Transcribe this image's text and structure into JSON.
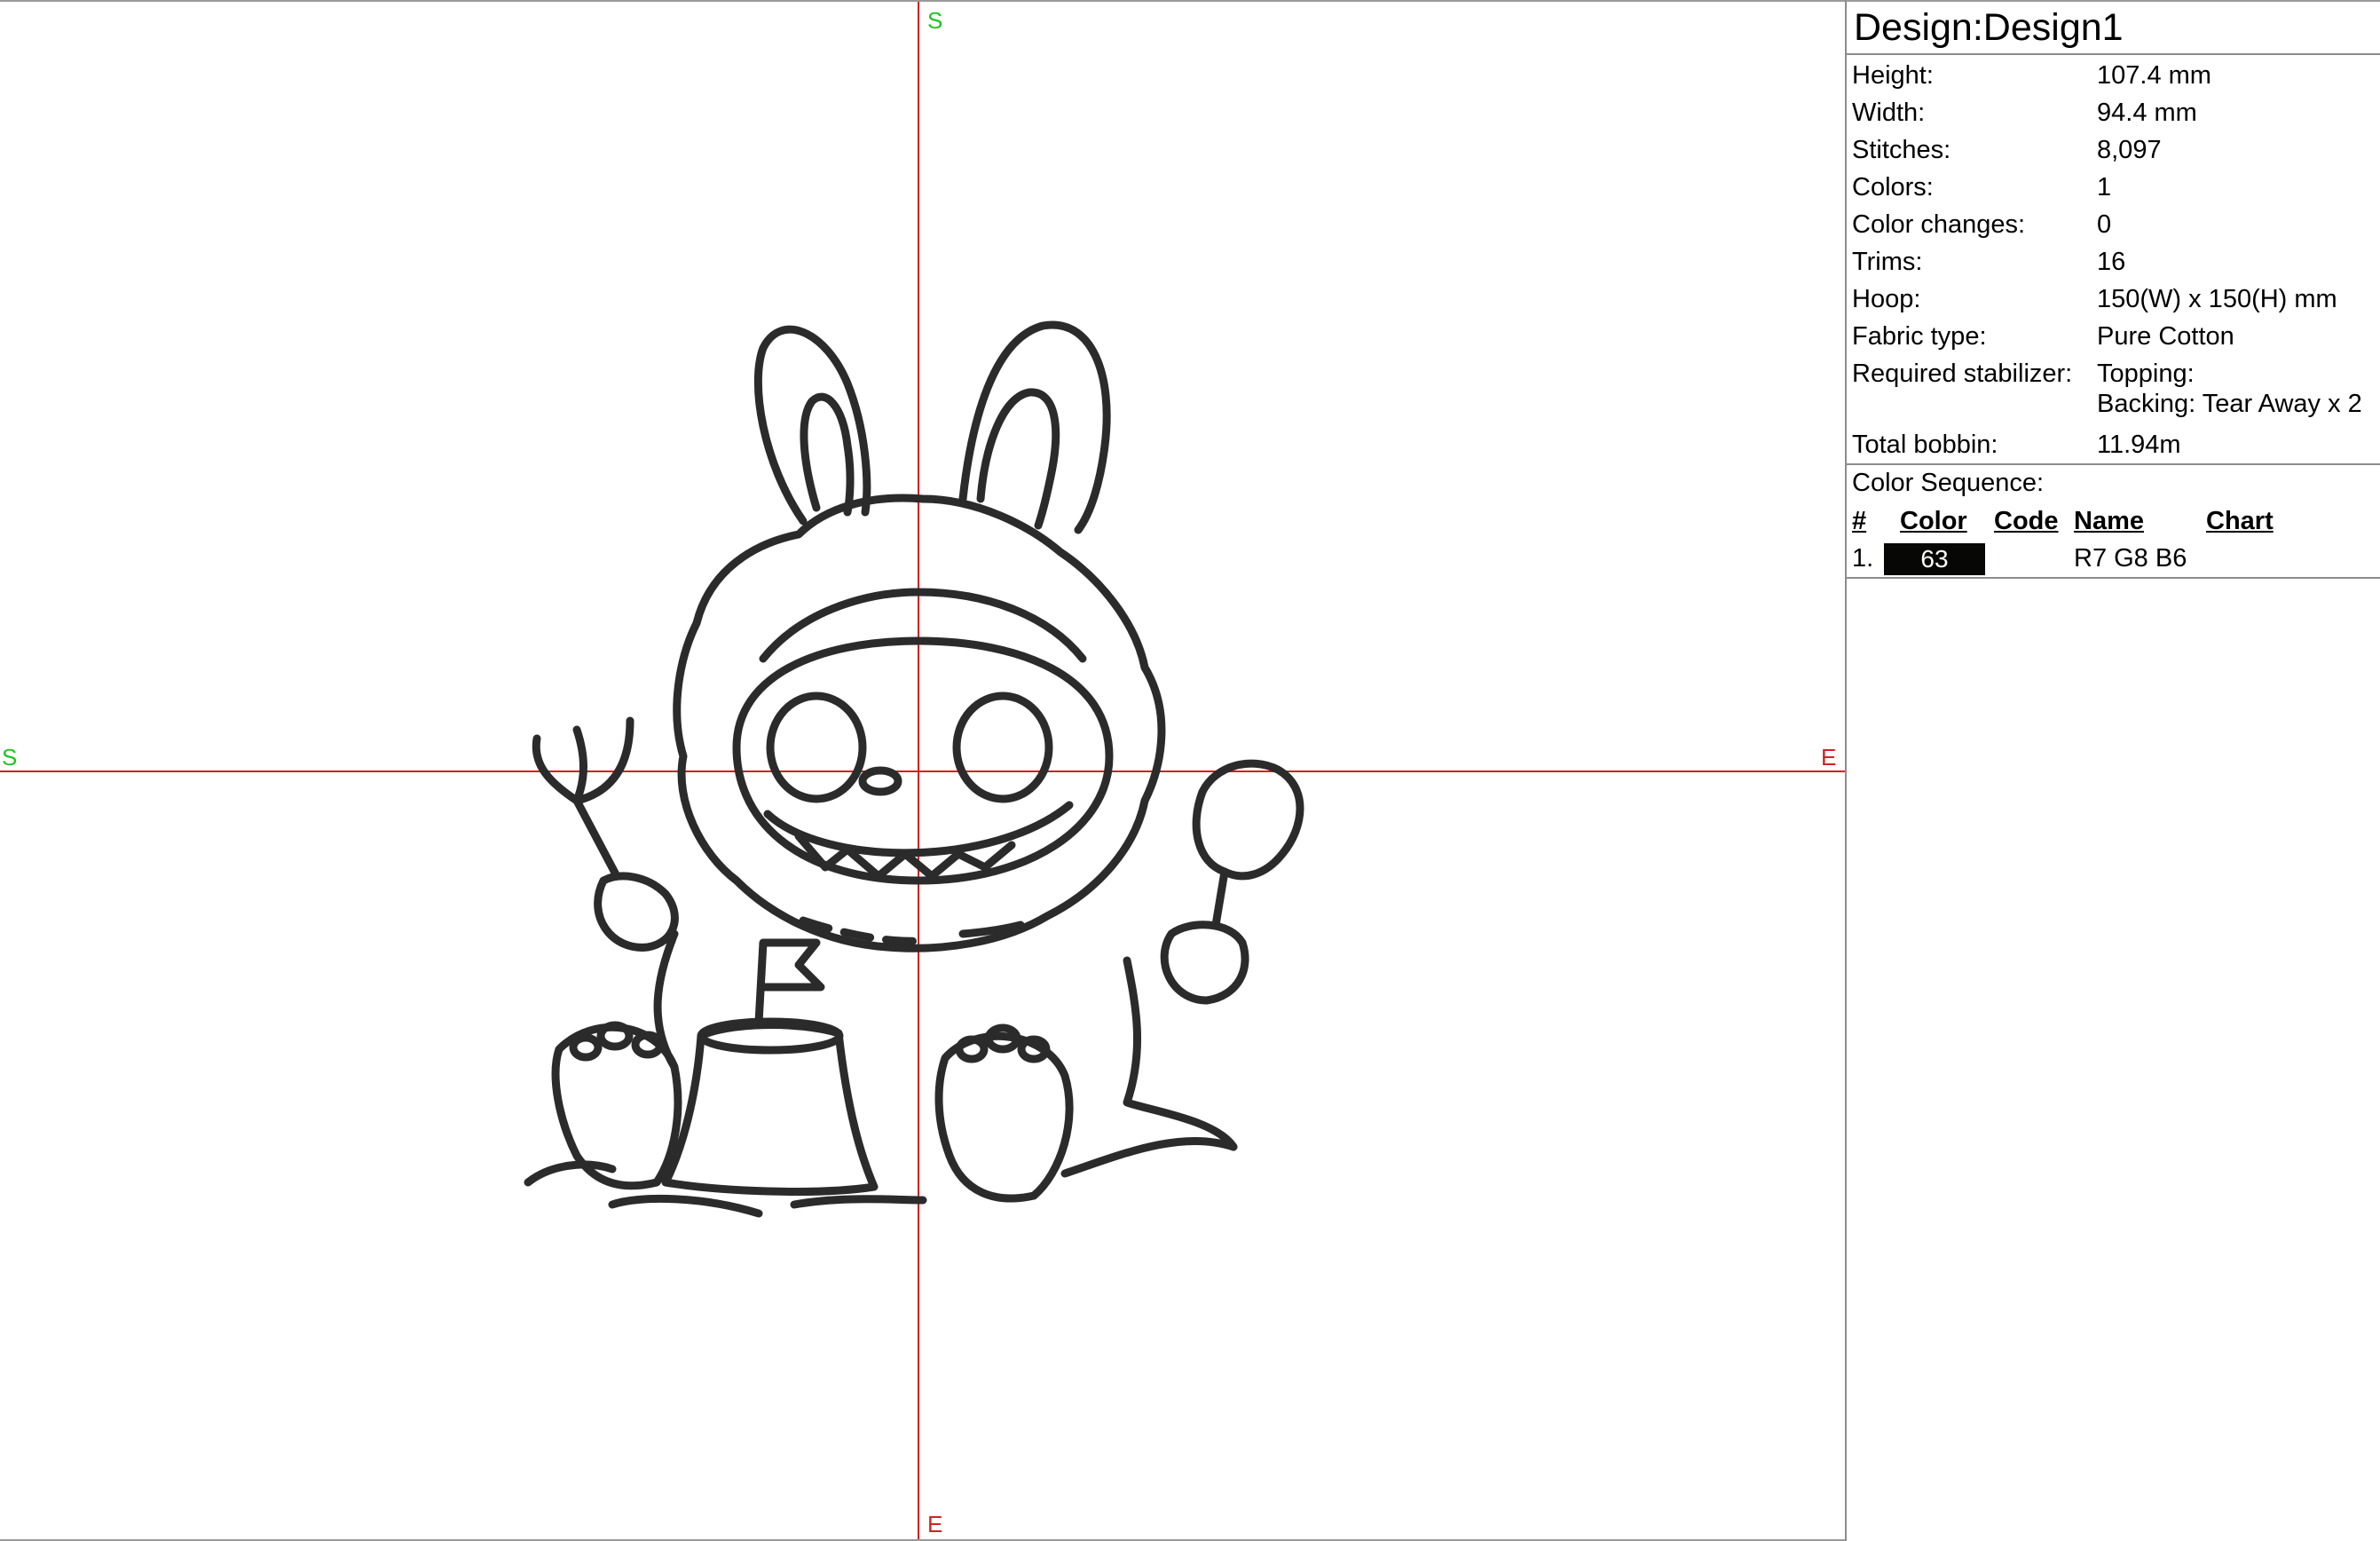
{
  "canvas": {
    "axis_labels": {
      "top": "S",
      "bottom": "E",
      "left": "S",
      "right": "E"
    },
    "colors": {
      "axis_line": "#d42020",
      "start_label": "#22c322",
      "end_label": "#d42020",
      "stitch": "#2b2b2b"
    }
  },
  "panel": {
    "title": "Design:Design1",
    "properties": [
      {
        "label": "Height:",
        "value": "107.4 mm"
      },
      {
        "label": "Width:",
        "value": "94.4 mm"
      },
      {
        "label": "Stitches:",
        "value": "8,097"
      },
      {
        "label": "Colors:",
        "value": "1"
      },
      {
        "label": "Color changes:",
        "value": "0"
      },
      {
        "label": "Trims:",
        "value": "16"
      },
      {
        "label": "Hoop:",
        "value": "150(W) x 150(H) mm"
      },
      {
        "label": "Fabric type:",
        "value": "Pure Cotton"
      }
    ],
    "stabilizer": {
      "label": "Required stabilizer:",
      "line1": "Topping:",
      "line2": "Backing: Tear Away x 2"
    },
    "bobbin": {
      "label": "Total bobbin:",
      "value": "11.94m"
    },
    "color_sequence": {
      "title": "Color Sequence:",
      "headers": {
        "num": "#",
        "color": "Color",
        "code": "Code",
        "name": "Name",
        "chart": "Chart"
      },
      "rows": [
        {
          "num": "1.",
          "swatch_text": "63",
          "swatch_color": "#070806",
          "code": "",
          "name": "R7 G8 B6",
          "chart": ""
        }
      ]
    }
  }
}
